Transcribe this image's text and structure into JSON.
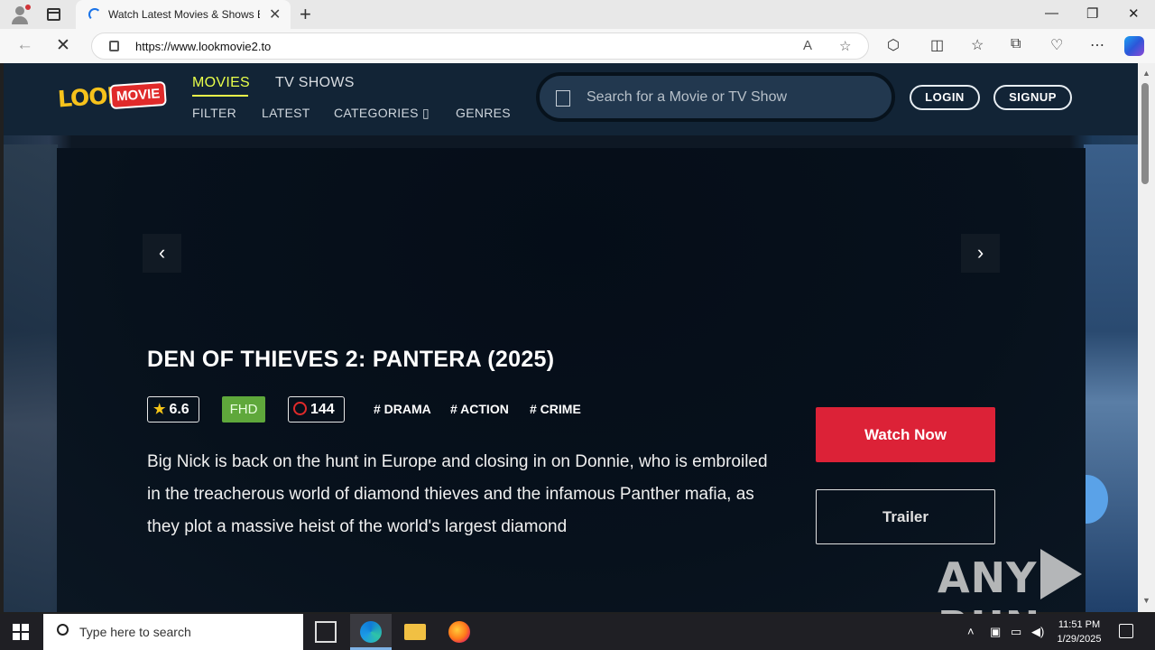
{
  "browser": {
    "tab_title": "Watch Latest Movies & Shows Ep",
    "tab_close": "✕",
    "new_tab": "+",
    "url": "https://www.lookmovie2.to",
    "window_controls": [
      "—",
      "❐",
      "✕"
    ]
  },
  "site": {
    "logo_look": "LOOK",
    "logo_movie": "MOVIE",
    "nav_main": [
      "MOVIES",
      "TV SHOWS"
    ],
    "nav_sub": [
      "FILTER",
      "LATEST",
      "CATEGORIES ▯",
      "GENRES"
    ],
    "search_placeholder": "Search for a Movie or TV Show",
    "login": "LOGIN",
    "signup": "SIGNUP"
  },
  "hero": {
    "prev": "‹",
    "next": "›",
    "title": "DEN OF THIEVES 2: PANTERA (2025)",
    "rating": "6.6",
    "quality": "FHD",
    "duration": "144",
    "genres": [
      "# DRAMA",
      "# ACTION",
      "# CRIME"
    ],
    "description": "Big Nick is back on the hunt in Europe and closing in on Donnie, who is embroiled in the treacherous world of diamond thieves and the infamous Panther mafia, as they plot a massive heist of the world's largest diamond",
    "watch_now": "Watch Now",
    "trailer": "Trailer"
  },
  "watermark": {
    "left": "ANY",
    "right": "RUN"
  },
  "taskbar": {
    "search_placeholder": "Type here to search",
    "time": "11:51 PM",
    "date": "1/29/2025"
  }
}
